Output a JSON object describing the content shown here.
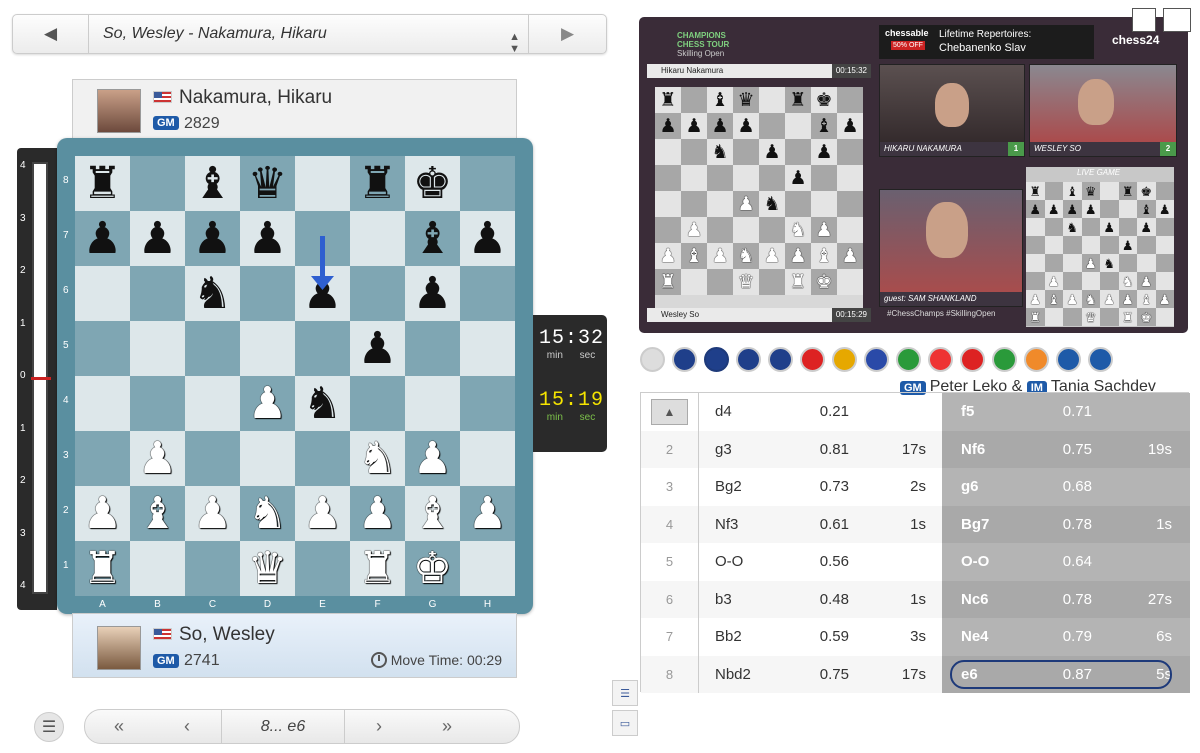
{
  "game_selector": {
    "title": "So, Wesley - Nakamura, Hikaru",
    "prev_icon": "chevron-left-icon",
    "next_icon": "chevron-right-icon"
  },
  "top_player": {
    "name": "Nakamura, Hikaru",
    "title": "GM",
    "rating": "2829",
    "flag": "us-flag-icon"
  },
  "bottom_player": {
    "name": "So, Wesley",
    "title": "GM",
    "rating": "2741",
    "move_time": "Move Time: 00:29",
    "flag": "us-flag-icon"
  },
  "eval_bar": {
    "ticks": [
      "4",
      "3",
      "2",
      "1",
      "0",
      "1",
      "2",
      "3",
      "4"
    ],
    "eval": 0.0
  },
  "clocks": {
    "top": {
      "min": "15",
      "sec": "32",
      "min_label": "min",
      "sec_label": "sec"
    },
    "bottom": {
      "min": "15",
      "sec": "19",
      "min_label": "min",
      "sec_label": "sec"
    }
  },
  "board": {
    "files": [
      "A",
      "B",
      "C",
      "D",
      "E",
      "F",
      "G",
      "H"
    ],
    "ranks": [
      "8",
      "7",
      "6",
      "5",
      "4",
      "3",
      "2",
      "1"
    ],
    "position": [
      [
        "bR",
        "",
        "bB",
        "bQ",
        "",
        "bR",
        "bK",
        ""
      ],
      [
        "bP",
        "bP",
        "bP",
        "bP",
        "",
        "",
        "bB",
        "bP"
      ],
      [
        "",
        "",
        "bN",
        "",
        "bP",
        "",
        "bP",
        ""
      ],
      [
        "",
        "",
        "",
        "",
        "",
        "bP",
        "",
        ""
      ],
      [
        "",
        "",
        "",
        "wP",
        "bN",
        "",
        "",
        ""
      ],
      [
        "",
        "wP",
        "",
        "",
        "",
        "wN",
        "wP",
        ""
      ],
      [
        "wP",
        "wB",
        "wP",
        "wN",
        "wP",
        "wP",
        "wB",
        "wP"
      ],
      [
        "wR",
        "",
        "",
        "wQ",
        "",
        "wR",
        "wK",
        ""
      ]
    ],
    "last_move_arrow": {
      "from": "e7",
      "to": "e6"
    }
  },
  "navigation": {
    "current_move": "8... e6"
  },
  "video": {
    "event_name": "CHAMPIONS CHESS TOUR",
    "event_sub": "Skilling Open",
    "ad_brand": "chessable",
    "ad_badge": "50% OFF",
    "ad_text_1": "Lifetime Repertoires:",
    "ad_text_2": "Chebanenko Slav",
    "site_logo": "chess24",
    "top_player_bar": "Hikaru Nakamura",
    "top_player_time": "00:15:32",
    "bottom_player_bar": "Wesley So",
    "bottom_player_time": "00:15:29",
    "cam1_label": "HIKARU NAKAMURA",
    "cam1_score": "1",
    "cam2_label": "WESLEY SO",
    "cam2_score": "2",
    "guest_label": "guest: SAM SHANKLAND",
    "hashtags": "#ChessChamps  #SkillingOpen",
    "live_game": "LIVE GAME"
  },
  "languages": [
    "video-icon",
    "en-flag",
    "en-flag",
    "en-flag",
    "en-flag",
    "de-flag",
    "es-flag",
    "fr-flag",
    "br-flag",
    "ru-flag",
    "tr-flag",
    "it-flag",
    "in-flag",
    "chat-icon",
    "chat-icon"
  ],
  "commentators": {
    "badge1": "GM",
    "name1": "Peter Leko &",
    "badge2": "IM",
    "name2": "Tania Sachdev"
  },
  "moves": [
    {
      "n": "1",
      "w": "d4",
      "we": "0.21",
      "wt": "",
      "b": "f5",
      "be": "0.71",
      "bt": ""
    },
    {
      "n": "2",
      "w": "g3",
      "we": "0.81",
      "wt": "17s",
      "b": "Nf6",
      "be": "0.75",
      "bt": "19s"
    },
    {
      "n": "3",
      "w": "Bg2",
      "we": "0.73",
      "wt": "2s",
      "b": "g6",
      "be": "0.68",
      "bt": ""
    },
    {
      "n": "4",
      "w": "Nf3",
      "we": "0.61",
      "wt": "1s",
      "b": "Bg7",
      "be": "0.78",
      "bt": "1s"
    },
    {
      "n": "5",
      "w": "O-O",
      "we": "0.56",
      "wt": "",
      "b": "O-O",
      "be": "0.64",
      "bt": ""
    },
    {
      "n": "6",
      "w": "b3",
      "we": "0.48",
      "wt": "1s",
      "b": "Nc6",
      "be": "0.78",
      "bt": "27s"
    },
    {
      "n": "7",
      "w": "Bb2",
      "we": "0.59",
      "wt": "3s",
      "b": "Ne4",
      "be": "0.79",
      "bt": "6s"
    },
    {
      "n": "8",
      "w": "Nbd2",
      "we": "0.75",
      "wt": "17s",
      "b": "e6",
      "be": "0.87",
      "bt": "5s"
    }
  ]
}
